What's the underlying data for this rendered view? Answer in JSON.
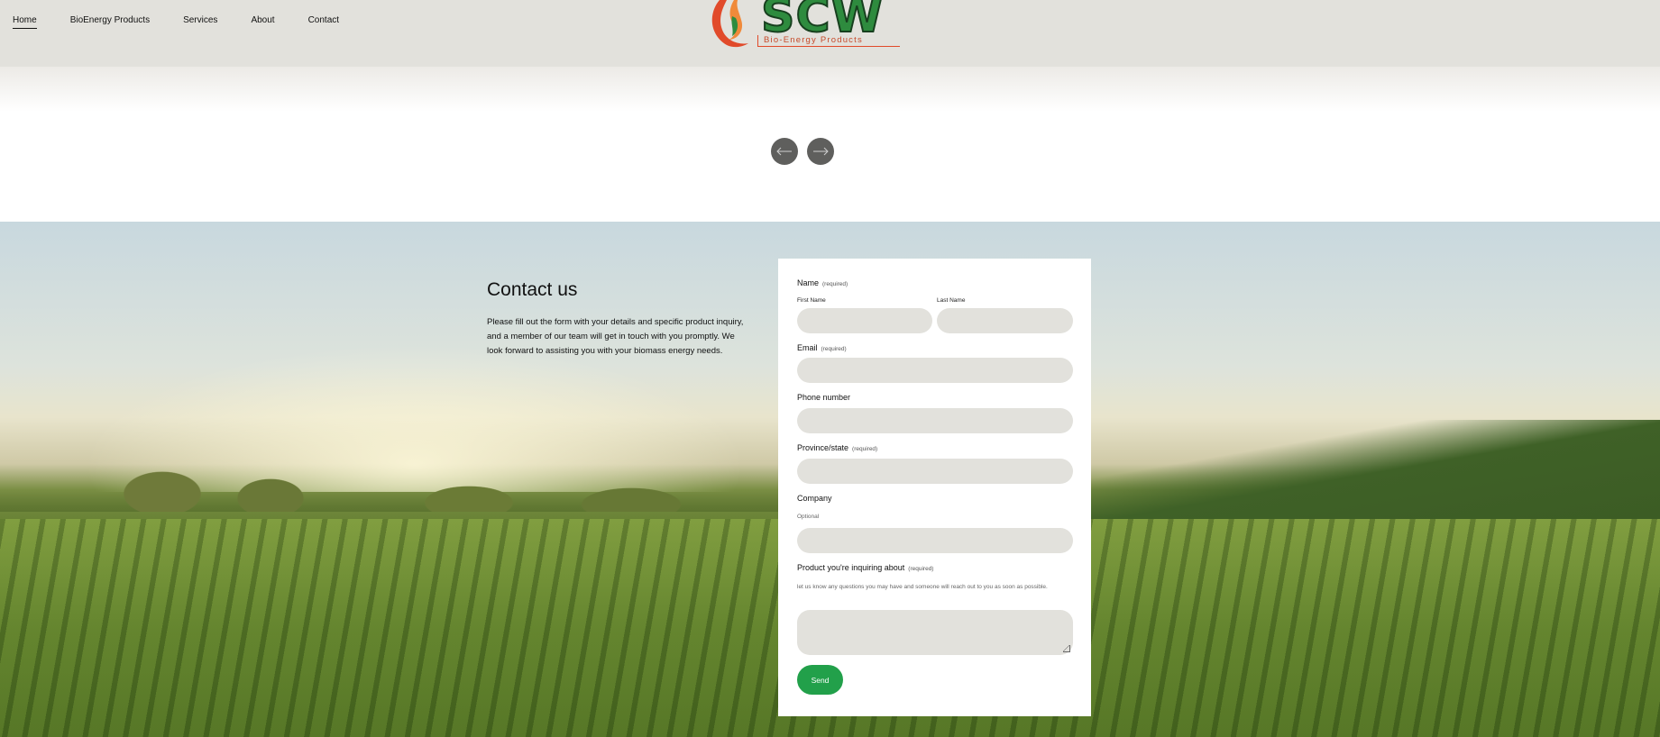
{
  "nav": {
    "items": [
      {
        "label": "Home",
        "active": true
      },
      {
        "label": "BioEnergy Products",
        "active": false
      },
      {
        "label": "Services",
        "active": false
      },
      {
        "label": "About",
        "active": false
      },
      {
        "label": "Contact",
        "active": false
      }
    ]
  },
  "logo": {
    "text": "SCW",
    "tagline": "Bio-Energy Products",
    "icon": "flame-icon"
  },
  "slider": {
    "prev_icon": "arrow-left-icon",
    "next_icon": "arrow-right-icon"
  },
  "contact": {
    "title": "Contact us",
    "description": "Please fill out the form with your details and specific product inquiry, and a member of our team will get in touch with you promptly. We look forward to assisting you with your biomass energy needs."
  },
  "form": {
    "name": {
      "label": "Name",
      "required": "(required)",
      "first_label": "First Name",
      "last_label": "Last Name"
    },
    "email": {
      "label": "Email",
      "required": "(required)"
    },
    "phone": {
      "label": "Phone number"
    },
    "province": {
      "label": "Province/state",
      "required": "(required)"
    },
    "company": {
      "label": "Company",
      "hint": "Optional"
    },
    "product": {
      "label": "Product you're inquiring about",
      "required": "(required)",
      "hint": "let us know any questions you may have and someone will reach out to you as soon as possible."
    },
    "send_label": "Send"
  },
  "colors": {
    "header_bg": "#e2e1dc",
    "accent_green": "#22a04a",
    "logo_green": "#2e8b3e",
    "logo_red": "#e14a2a",
    "input_bg": "#e2e1dc",
    "arrow_bg": "#5f5f5d"
  }
}
